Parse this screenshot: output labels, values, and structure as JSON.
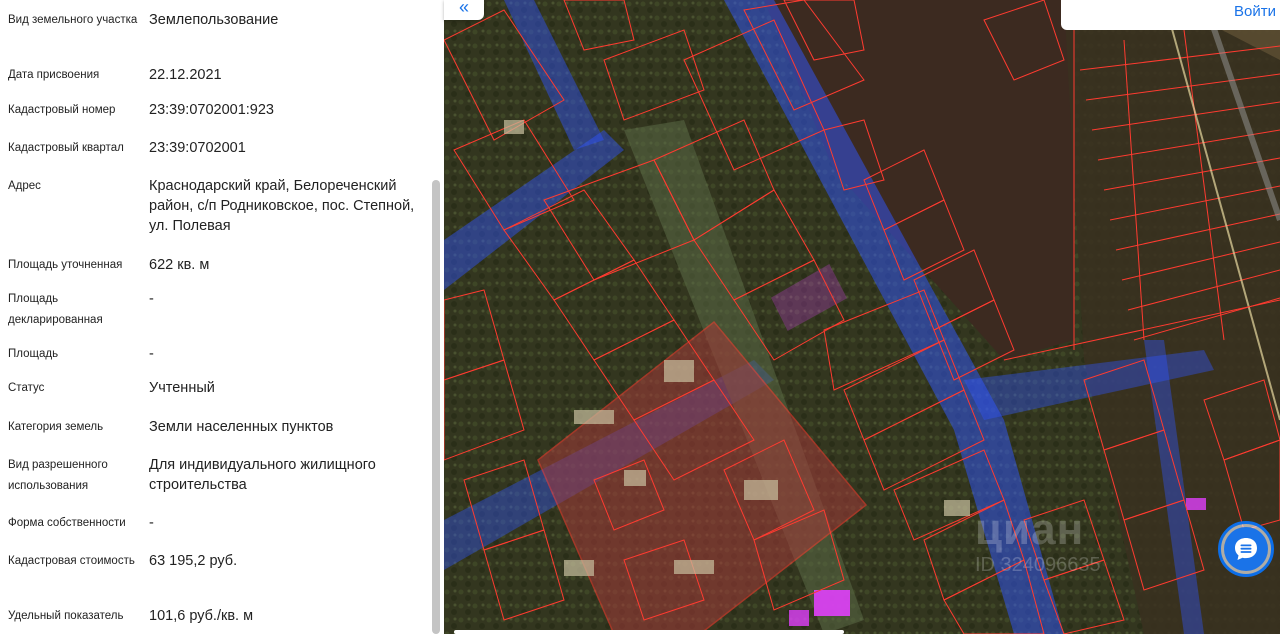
{
  "info_panel": {
    "rows": [
      {
        "label": "Вид земельного участка",
        "value": "Землепользование"
      },
      {
        "label": "Дата присвоения",
        "value": "22.12.2021"
      },
      {
        "label": "Кадастровый номер",
        "value": "23:39:0702001:923"
      },
      {
        "label": "Кадастровый квартал",
        "value": "23:39:0702001"
      },
      {
        "label": "Адрес",
        "value": "Краснодарский край, Белореченский район, с/п Родниковское, пос. Степной, ул. Полевая"
      },
      {
        "label": "Площадь уточненная",
        "value": "622 кв. м"
      },
      {
        "label": "Площадь декларированная",
        "value": "-"
      },
      {
        "label": "Площадь",
        "value": "-"
      },
      {
        "label": "Статус",
        "value": "Учтенный"
      },
      {
        "label": "Категория земель",
        "value": "Земли населенных пунктов"
      },
      {
        "label": "Вид разрешенного использования",
        "value": "Для индивидуального жилищного строительства"
      },
      {
        "label": "Форма собственности",
        "value": "-"
      },
      {
        "label": "Кадастровая стоимость",
        "value": "63 195,2 руб."
      },
      {
        "label": "Удельный показатель",
        "value": "101,6 руб./кв. м"
      }
    ]
  },
  "map": {
    "collapse_icon": "double-chevron-left-icon",
    "collapse_glyph": "«",
    "login_label": "Войти",
    "watermark": "циан",
    "watermark_sub": "ID 324096635",
    "chat_icon": "chat-icon",
    "colors": {
      "parcel_border": "#ff3b30",
      "road_overlay": "#2f55ff",
      "selected_parcel": "#ff6b6b",
      "highlight_parcel": "#e040fb",
      "accent": "#1a73e8"
    }
  }
}
